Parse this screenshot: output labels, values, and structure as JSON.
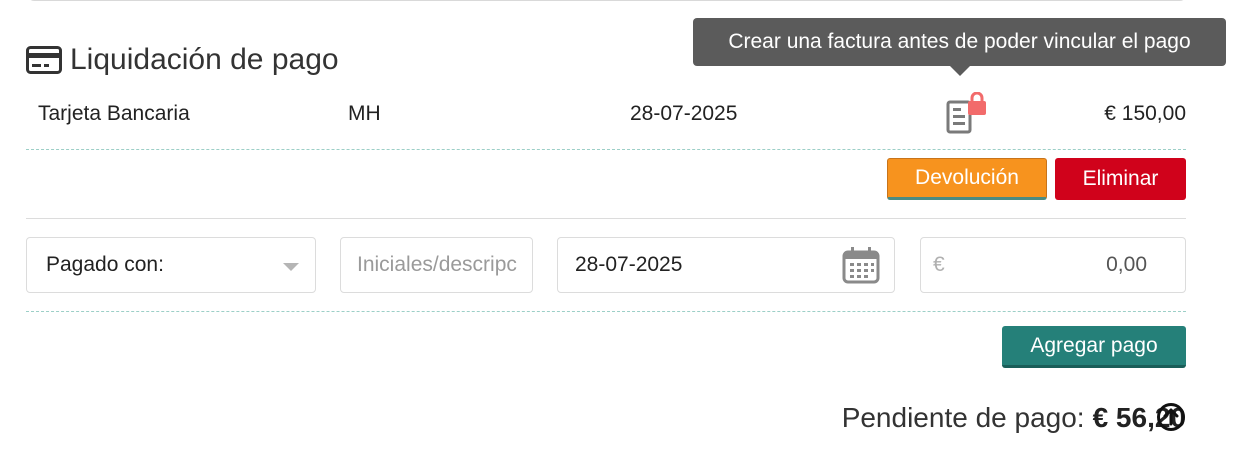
{
  "section": {
    "title": "Liquidación de pago",
    "icon": "credit-card-icon"
  },
  "tooltip": {
    "text": "Crear una factura antes de poder vincular el pago"
  },
  "payment_row": {
    "method": "Tarjeta Bancaria",
    "initials": "MH",
    "date": "28-07-2025",
    "amount": "€ 150,00",
    "invoice_icon": "locked-invoice-icon"
  },
  "actions": {
    "refund_label": "Devolución",
    "delete_label": "Eliminar"
  },
  "form": {
    "paid_with_label": "Pagado con:",
    "initials_placeholder": "Iniciales/descripción",
    "date_value": "28-07-2025",
    "currency_symbol": "€",
    "amount_value": "0,00",
    "add_label": "Agregar pago"
  },
  "pending": {
    "label": "Pendiente de pago:",
    "amount": "€ 56,20"
  },
  "colors": {
    "refund": "#f7931e",
    "delete": "#d0021b",
    "add": "#258079",
    "tooltip_bg": "#5b5b5b",
    "lock": "#f26b6b"
  }
}
